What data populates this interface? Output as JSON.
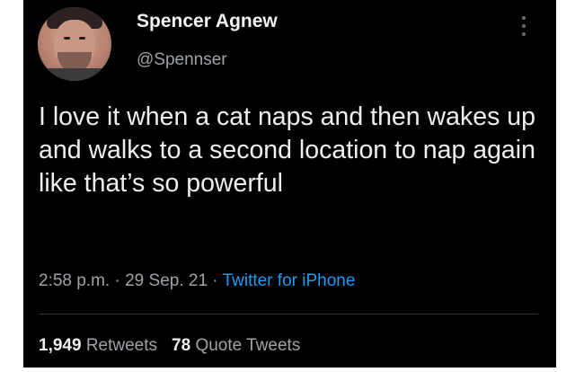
{
  "tweet": {
    "author": {
      "display_name": "Spencer Agnew",
      "handle": "@Spennser"
    },
    "text": "I love it when a cat naps and then wakes up and walks to a second location to nap again like that’s so powerful",
    "time": "2:58 p.m.",
    "separator": " · ",
    "date": "29 Sep. 21",
    "source": "Twitter for iPhone",
    "stats": {
      "retweets_count": "1,949",
      "retweets_label": "Retweets",
      "quote_tweets_count": "78",
      "quote_tweets_label": "Quote Tweets"
    }
  },
  "icons": {
    "more": "more-vertical-icon"
  },
  "colors": {
    "background": "#000000",
    "text": "#e7e9ea",
    "muted": "#9ea3a8",
    "link": "#1d9bf0",
    "divider": "#2f3336"
  }
}
